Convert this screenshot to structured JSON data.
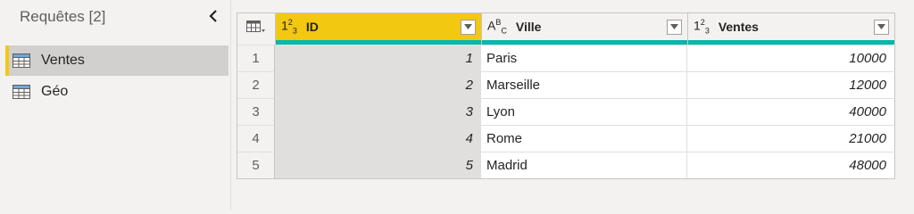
{
  "queries_pane": {
    "title": "Requêtes [2]",
    "items": [
      {
        "label": "Ventes",
        "selected": true
      },
      {
        "label": "Géo",
        "selected": false
      }
    ]
  },
  "grid": {
    "columns": [
      {
        "type_glyph_main": "1",
        "type_glyph_sup": "2",
        "type_glyph_sub": "3",
        "label": "ID"
      },
      {
        "type_glyph_main": "A",
        "type_glyph_sup": "B",
        "type_glyph_sub": "C",
        "label": "Ville"
      },
      {
        "type_glyph_main": "1",
        "type_glyph_sup": "2",
        "type_glyph_sub": "3",
        "label": "Ventes"
      }
    ],
    "rows": [
      {
        "num": "1",
        "id": "1",
        "ville": "Paris",
        "ventes": "10000"
      },
      {
        "num": "2",
        "id": "2",
        "ville": "Marseille",
        "ventes": "12000"
      },
      {
        "num": "3",
        "id": "3",
        "ville": "Lyon",
        "ventes": "40000"
      },
      {
        "num": "4",
        "id": "4",
        "ville": "Rome",
        "ventes": "21000"
      },
      {
        "num": "5",
        "id": "5",
        "ville": "Madrid",
        "ventes": "48000"
      }
    ]
  },
  "colors": {
    "accent_yellow": "#f2c811",
    "quality_bar": "#01b8aa",
    "selection_gray": "#e1dfdd"
  }
}
